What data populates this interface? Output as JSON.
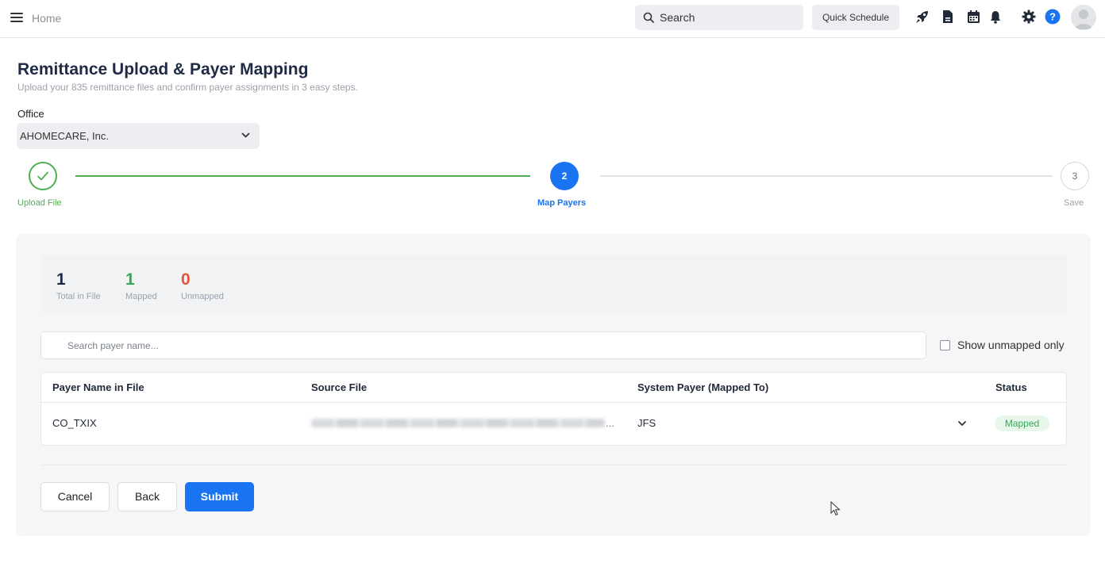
{
  "topbar": {
    "breadcrumb": "Home",
    "search_label": "Search",
    "quick_schedule_label": "Quick Schedule",
    "icons": [
      "menu-icon",
      "rocket-icon",
      "document-icon",
      "calendar-icon",
      "bell-icon",
      "gear-icon",
      "help-icon",
      "avatar"
    ]
  },
  "header": {
    "title": "Remittance Upload & Payer Mapping",
    "subtitle": "Upload your 835 remittance files and confirm payer assignments in 3 easy steps."
  },
  "office": {
    "label": "Office",
    "selected": "AHOMECARE, Inc."
  },
  "stepper": {
    "steps": [
      {
        "number": "1",
        "label": "Upload File",
        "state": "complete"
      },
      {
        "number": "2",
        "label": "Map Payers",
        "state": "active"
      },
      {
        "number": "3",
        "label": "Save",
        "state": "pending"
      }
    ]
  },
  "stats": {
    "total": {
      "value": "1",
      "label": "Total in File"
    },
    "mapped": {
      "value": "1",
      "label": "Mapped"
    },
    "unmapped": {
      "value": "0",
      "label": "Unmapped"
    }
  },
  "filter": {
    "search_placeholder": "Search payer name...",
    "show_unmapped_label": "Show unmapped only",
    "show_unmapped_checked": false
  },
  "table": {
    "columns": [
      "Payer Name in File",
      "Source File",
      "System Payer (Mapped To)",
      "Status"
    ],
    "rows": [
      {
        "payer_name": "CO_TXIX",
        "source_file_ellipsis": "...",
        "system_payer": "JFS",
        "status": "Mapped"
      }
    ]
  },
  "actions": {
    "cancel": "Cancel",
    "back": "Back",
    "submit": "Submit"
  },
  "colors": {
    "primary": "#1a73f0",
    "success": "#34a853",
    "danger": "#e5533d",
    "title": "#1f2a44"
  }
}
